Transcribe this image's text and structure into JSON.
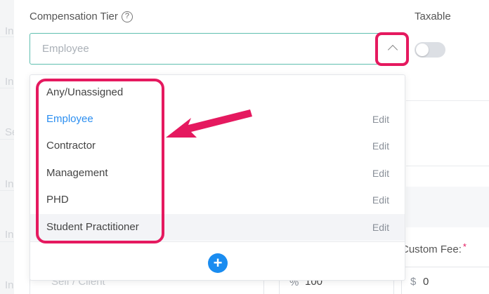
{
  "form": {
    "compensation_label": "Compensation Tier",
    "help_icon_glyph": "?",
    "taxable_label": "Taxable",
    "taxable_on": false,
    "select": {
      "value": "Employee"
    }
  },
  "dropdown": {
    "options": [
      {
        "label": "Any/Unassigned",
        "edit": ""
      },
      {
        "label": "Employee",
        "edit": "Edit"
      },
      {
        "label": "Contractor",
        "edit": "Edit"
      },
      {
        "label": "Management",
        "edit": "Edit"
      },
      {
        "label": "PHD",
        "edit": "Edit"
      },
      {
        "label": "Student Practitioner",
        "edit": "Edit"
      }
    ],
    "add_glyph": "+"
  },
  "background": {
    "rail_fragments": [
      "In",
      "In",
      "Se",
      "In",
      "In",
      "In"
    ],
    "custom_fee_label": "Custom Fee:",
    "required_mark": "*",
    "self_client_placeholder": "Self / Client",
    "percent_symbol": "%",
    "percent_value": "100",
    "dollar_symbol": "$",
    "fee_value": "0"
  },
  "colors": {
    "accent_blue": "#2b8ef0",
    "annotation_pink": "#e5195f",
    "focus_teal": "#5fbfb0"
  }
}
